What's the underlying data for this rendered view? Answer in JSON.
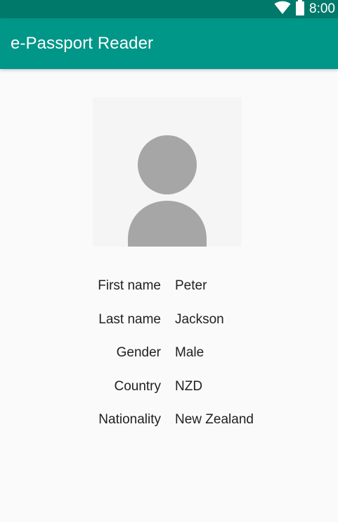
{
  "status_bar": {
    "time": "8:00",
    "icons": [
      "wifi-icon",
      "battery-icon"
    ]
  },
  "app_bar": {
    "title": "e-Passport Reader"
  },
  "photo": {
    "icon": "person-placeholder-icon"
  },
  "details": [
    {
      "label": "First name",
      "value": "Peter"
    },
    {
      "label": "Last name",
      "value": "Jackson"
    },
    {
      "label": "Gender",
      "value": "Male"
    },
    {
      "label": "Country",
      "value": "NZD"
    },
    {
      "label": "Nationality",
      "value": "New Zealand"
    }
  ],
  "colors": {
    "status_bar": "#00796b",
    "primary": "#009688",
    "background": "#fafafa",
    "placeholder": "#a6a6a6"
  }
}
